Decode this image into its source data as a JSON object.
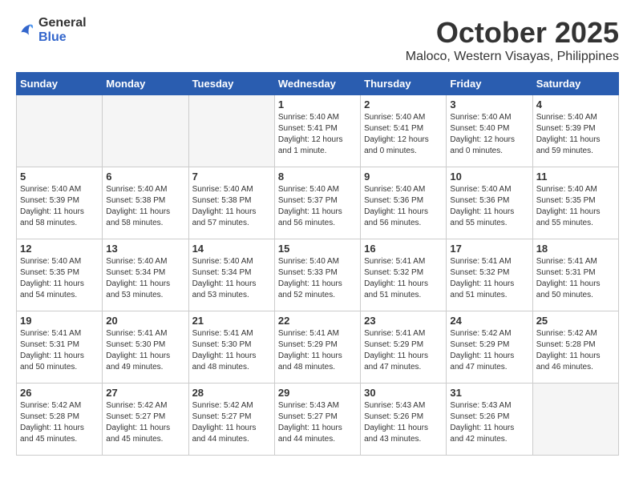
{
  "header": {
    "logo_general": "General",
    "logo_blue": "Blue",
    "month": "October 2025",
    "location": "Maloco, Western Visayas, Philippines"
  },
  "weekdays": [
    "Sunday",
    "Monday",
    "Tuesday",
    "Wednesday",
    "Thursday",
    "Friday",
    "Saturday"
  ],
  "weeks": [
    [
      {
        "day": "",
        "empty": true
      },
      {
        "day": "",
        "empty": true
      },
      {
        "day": "",
        "empty": true
      },
      {
        "day": "1",
        "sunrise": "5:40 AM",
        "sunset": "5:41 PM",
        "daylight": "12 hours and 1 minute."
      },
      {
        "day": "2",
        "sunrise": "5:40 AM",
        "sunset": "5:41 PM",
        "daylight": "12 hours and 0 minutes."
      },
      {
        "day": "3",
        "sunrise": "5:40 AM",
        "sunset": "5:40 PM",
        "daylight": "12 hours and 0 minutes."
      },
      {
        "day": "4",
        "sunrise": "5:40 AM",
        "sunset": "5:39 PM",
        "daylight": "11 hours and 59 minutes."
      }
    ],
    [
      {
        "day": "5",
        "sunrise": "5:40 AM",
        "sunset": "5:39 PM",
        "daylight": "11 hours and 58 minutes."
      },
      {
        "day": "6",
        "sunrise": "5:40 AM",
        "sunset": "5:38 PM",
        "daylight": "11 hours and 58 minutes."
      },
      {
        "day": "7",
        "sunrise": "5:40 AM",
        "sunset": "5:38 PM",
        "daylight": "11 hours and 57 minutes."
      },
      {
        "day": "8",
        "sunrise": "5:40 AM",
        "sunset": "5:37 PM",
        "daylight": "11 hours and 56 minutes."
      },
      {
        "day": "9",
        "sunrise": "5:40 AM",
        "sunset": "5:36 PM",
        "daylight": "11 hours and 56 minutes."
      },
      {
        "day": "10",
        "sunrise": "5:40 AM",
        "sunset": "5:36 PM",
        "daylight": "11 hours and 55 minutes."
      },
      {
        "day": "11",
        "sunrise": "5:40 AM",
        "sunset": "5:35 PM",
        "daylight": "11 hours and 55 minutes."
      }
    ],
    [
      {
        "day": "12",
        "sunrise": "5:40 AM",
        "sunset": "5:35 PM",
        "daylight": "11 hours and 54 minutes."
      },
      {
        "day": "13",
        "sunrise": "5:40 AM",
        "sunset": "5:34 PM",
        "daylight": "11 hours and 53 minutes."
      },
      {
        "day": "14",
        "sunrise": "5:40 AM",
        "sunset": "5:34 PM",
        "daylight": "11 hours and 53 minutes."
      },
      {
        "day": "15",
        "sunrise": "5:40 AM",
        "sunset": "5:33 PM",
        "daylight": "11 hours and 52 minutes."
      },
      {
        "day": "16",
        "sunrise": "5:41 AM",
        "sunset": "5:32 PM",
        "daylight": "11 hours and 51 minutes."
      },
      {
        "day": "17",
        "sunrise": "5:41 AM",
        "sunset": "5:32 PM",
        "daylight": "11 hours and 51 minutes."
      },
      {
        "day": "18",
        "sunrise": "5:41 AM",
        "sunset": "5:31 PM",
        "daylight": "11 hours and 50 minutes."
      }
    ],
    [
      {
        "day": "19",
        "sunrise": "5:41 AM",
        "sunset": "5:31 PM",
        "daylight": "11 hours and 50 minutes."
      },
      {
        "day": "20",
        "sunrise": "5:41 AM",
        "sunset": "5:30 PM",
        "daylight": "11 hours and 49 minutes."
      },
      {
        "day": "21",
        "sunrise": "5:41 AM",
        "sunset": "5:30 PM",
        "daylight": "11 hours and 48 minutes."
      },
      {
        "day": "22",
        "sunrise": "5:41 AM",
        "sunset": "5:29 PM",
        "daylight": "11 hours and 48 minutes."
      },
      {
        "day": "23",
        "sunrise": "5:41 AM",
        "sunset": "5:29 PM",
        "daylight": "11 hours and 47 minutes."
      },
      {
        "day": "24",
        "sunrise": "5:42 AM",
        "sunset": "5:29 PM",
        "daylight": "11 hours and 47 minutes."
      },
      {
        "day": "25",
        "sunrise": "5:42 AM",
        "sunset": "5:28 PM",
        "daylight": "11 hours and 46 minutes."
      }
    ],
    [
      {
        "day": "26",
        "sunrise": "5:42 AM",
        "sunset": "5:28 PM",
        "daylight": "11 hours and 45 minutes."
      },
      {
        "day": "27",
        "sunrise": "5:42 AM",
        "sunset": "5:27 PM",
        "daylight": "11 hours and 45 minutes."
      },
      {
        "day": "28",
        "sunrise": "5:42 AM",
        "sunset": "5:27 PM",
        "daylight": "11 hours and 44 minutes."
      },
      {
        "day": "29",
        "sunrise": "5:43 AM",
        "sunset": "5:27 PM",
        "daylight": "11 hours and 44 minutes."
      },
      {
        "day": "30",
        "sunrise": "5:43 AM",
        "sunset": "5:26 PM",
        "daylight": "11 hours and 43 minutes."
      },
      {
        "day": "31",
        "sunrise": "5:43 AM",
        "sunset": "5:26 PM",
        "daylight": "11 hours and 42 minutes."
      },
      {
        "day": "",
        "empty": true
      }
    ]
  ]
}
